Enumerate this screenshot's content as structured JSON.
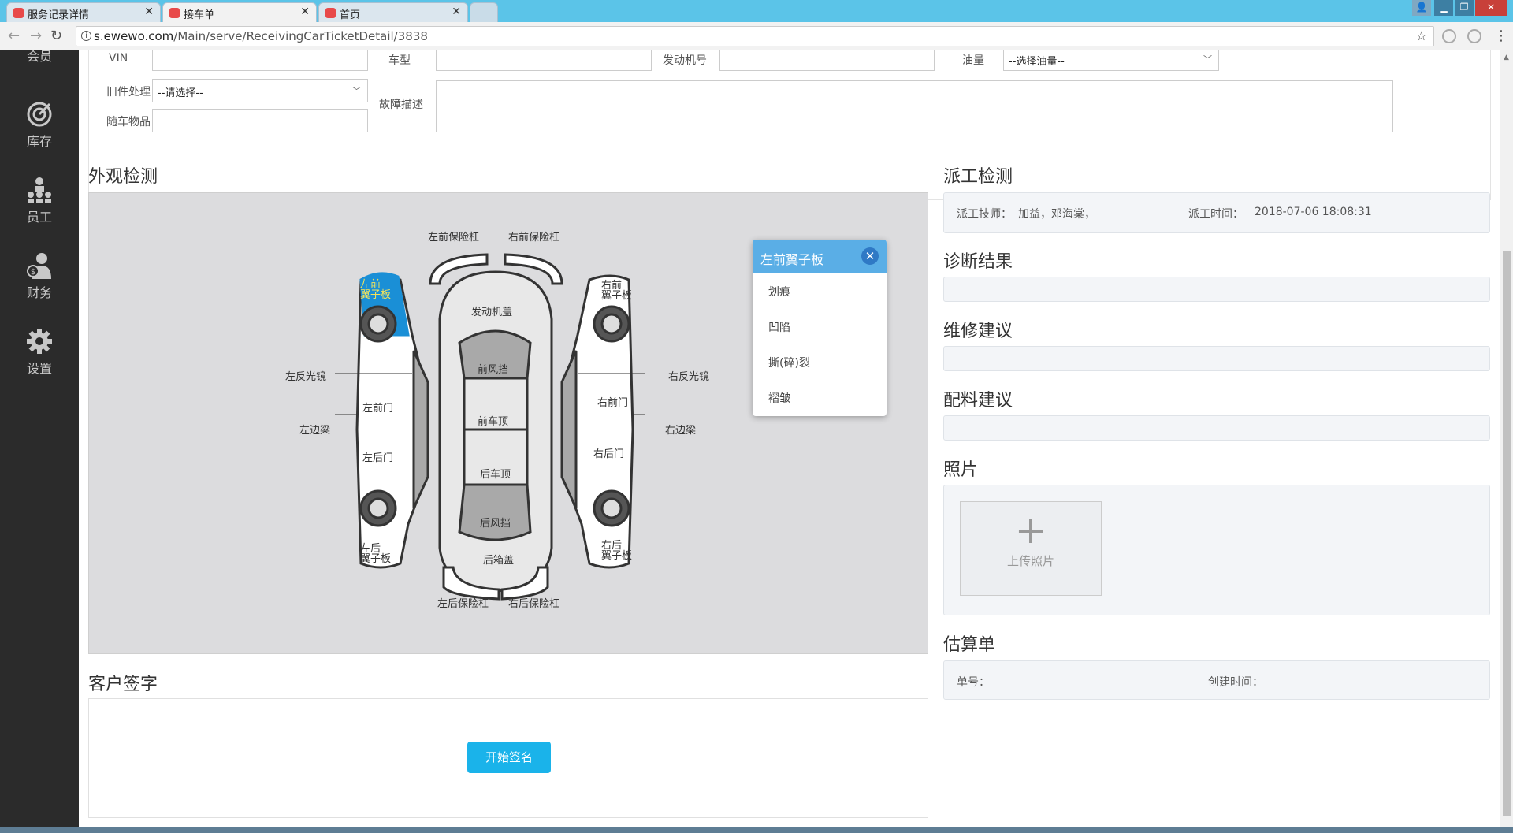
{
  "browser": {
    "tabs": [
      {
        "label": "服务记录详情",
        "active": false
      },
      {
        "label": "接车单",
        "active": true
      },
      {
        "label": "首页",
        "active": false
      }
    ],
    "url_host": "s.ewewo.com",
    "url_path": "/Main/serve/ReceivingCarTicketDetail/3838"
  },
  "sidebar": {
    "items": [
      {
        "label": "会员",
        "icon": "member-icon"
      },
      {
        "label": "库存",
        "icon": "inventory-icon"
      },
      {
        "label": "员工",
        "icon": "staff-icon"
      },
      {
        "label": "财务",
        "icon": "finance-icon"
      },
      {
        "label": "设置",
        "icon": "settings-gear-icon"
      }
    ]
  },
  "form": {
    "vin_label": "VIN",
    "vin_value": "",
    "model_label": "车型",
    "model_value": "",
    "engine_label": "发动机号",
    "engine_value": "",
    "fuel_label": "油量",
    "fuel_value": "--选择油量--",
    "oldparts_label": "旧件处理",
    "oldparts_value": "--请选择--",
    "fault_label": "故障描述",
    "fault_value": "",
    "items_label": "随车物品",
    "items_value": ""
  },
  "appearance": {
    "title": "外观检测",
    "parts": {
      "front_bumper_left": "左前保险杠",
      "front_bumper_right": "右前保险杠",
      "hood": "发动机盖",
      "windshield": "前风挡",
      "front_roof": "前车顶",
      "rear_roof": "后车顶",
      "rear_windshield": "后风挡",
      "trunk": "后箱盖",
      "rear_bumper_left": "左后保险杠",
      "rear_bumper_right": "右后保险杠",
      "left_mirror": "左反光镜",
      "left_sill": "左边梁",
      "left_front_door": "左前门",
      "left_rear_door": "左后门",
      "left_front_fender_1": "左前",
      "left_front_fender_2": "翼子板",
      "left_rear_fender_1": "左后",
      "left_rear_fender_2": "翼子板",
      "right_mirror": "右反光镜",
      "right_sill": "右边梁",
      "right_front_door": "右前门",
      "right_rear_door": "右后门",
      "right_front_fender_1": "右前",
      "right_front_fender_2": "翼子板",
      "right_rear_fender_1": "右后",
      "right_rear_fender_2": "翼子板"
    },
    "highlight_color": "#1a8fd6",
    "popup": {
      "title": "左前翼子板",
      "options": [
        "划痕",
        "凹陷",
        "撕(碎)裂",
        "褶皱"
      ]
    }
  },
  "dispatch": {
    "title": "派工检测",
    "tech_label": "派工技师：",
    "tech_value": "加益，邓海棠，",
    "time_label": "派工时间：",
    "time_value": "2018-07-06 18:08:31"
  },
  "diagnosis": {
    "title": "诊断结果"
  },
  "repair": {
    "title": "维修建议"
  },
  "parts_advice": {
    "title": "配料建议"
  },
  "photos": {
    "title": "照片",
    "upload_label": "上传照片"
  },
  "estimate": {
    "title": "估算单",
    "no_label": "单号：",
    "created_label": "创建时间："
  },
  "signature": {
    "title": "客户签字",
    "button": "开始签名"
  }
}
